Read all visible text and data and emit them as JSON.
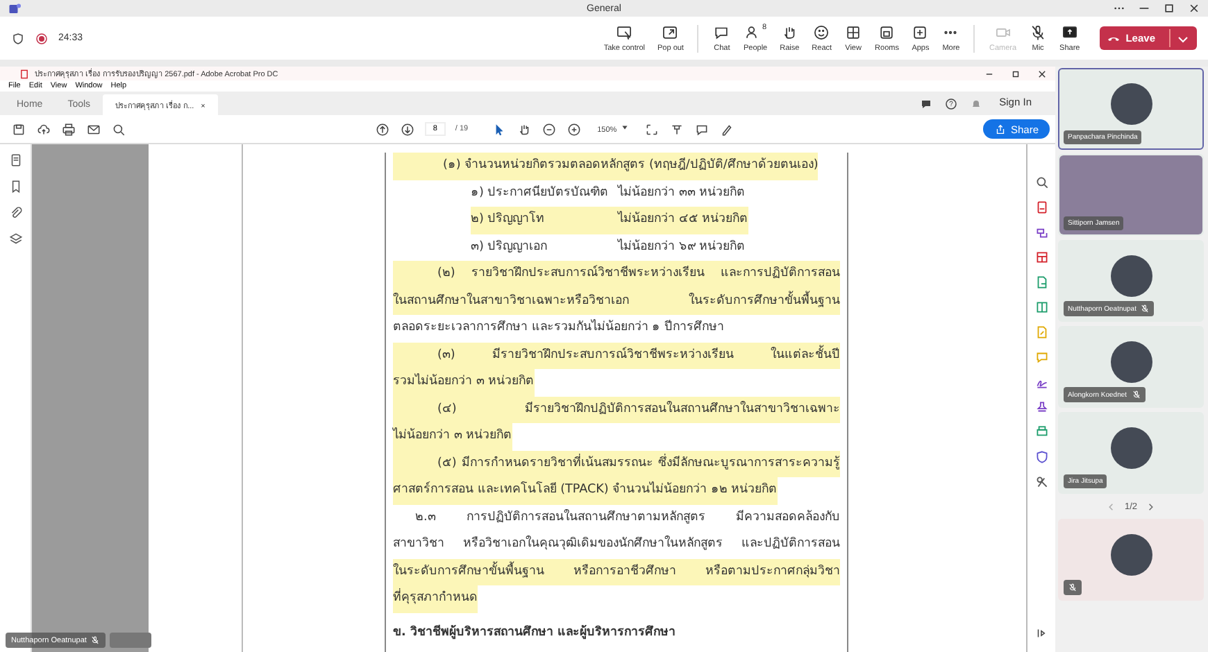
{
  "teams": {
    "title": "General",
    "timer": "24:33",
    "controls": [
      {
        "label": "Take control",
        "disabled": false
      },
      {
        "label": "Pop out",
        "disabled": false
      },
      {
        "label": "Chat",
        "disabled": false
      },
      {
        "label": "People",
        "disabled": false,
        "count": "8"
      },
      {
        "label": "Raise",
        "disabled": false
      },
      {
        "label": "React",
        "disabled": false
      },
      {
        "label": "View",
        "disabled": false
      },
      {
        "label": "Rooms",
        "disabled": false
      },
      {
        "label": "Apps",
        "disabled": false
      },
      {
        "label": "More",
        "disabled": false
      },
      {
        "label": "Camera",
        "disabled": true
      },
      {
        "label": "Mic",
        "disabled": false
      },
      {
        "label": "Share",
        "disabled": false
      }
    ],
    "leave": "Leave"
  },
  "acrobat": {
    "title": "ประกาศคุรุสภา เรื่อง การรับรองปริญญา 2567.pdf - Adobe Acrobat Pro DC",
    "menu": [
      "File",
      "Edit",
      "View",
      "Window",
      "Help"
    ],
    "tabs": [
      {
        "label": "Home",
        "selected": false
      },
      {
        "label": "Tools",
        "selected": false
      },
      {
        "label": "ประกาศคุรุสภา เรื่อง ก...",
        "selected": true,
        "close": "×"
      }
    ],
    "sign_in": "Sign In",
    "page": "8",
    "page_total": "/ 19",
    "zoom": "150%",
    "share": "Share"
  },
  "document": {
    "lines": [
      {
        "kind": "indent",
        "highlighted": true,
        "text": "(๑) จำนวนหน่วยกิตรวมตลอดหลักสูตร (ทฤษฎี/ปฏิบัติ/ศึกษาด้วยตนเอง)"
      },
      {
        "kind": "item",
        "highlighted": false,
        "text": "๑) ประกาศนียบัตรบัณฑิต",
        "value": "ไม่น้อยกว่า ๓๓ หน่วยกิต"
      },
      {
        "kind": "item",
        "highlighted": true,
        "text": "๒) ปริญญาโท",
        "value": "ไม่น้อยกว่า ๔๕ หน่วยกิต"
      },
      {
        "kind": "item",
        "highlighted": false,
        "text": "๓) ปริญญาเอก",
        "value": "ไม่น้อยกว่า ๖๙ หน่วยกิต"
      },
      {
        "kind": "first",
        "highlighted": true,
        "text": "(๒) รายวิชาฝึกประสบการณ์วิชาชีพระหว่างเรียน และการปฏิบัติการสอน"
      },
      {
        "kind": "full",
        "highlighted": true,
        "text": "ในสถานศึกษาในสาขาวิชาเฉพาะหรือวิชาเอก ในระดับการศึกษาขั้นพื้นฐาน"
      },
      {
        "kind": "last",
        "highlighted": false,
        "text": "ตลอดระยะเวลาการศึกษา และรวมกันไม่น้อยกว่า ๑ ปีการศึกษา"
      },
      {
        "kind": "first",
        "highlighted": true,
        "text": "(๓) มีรายวิชาฝึกประสบการณ์วิชาชีพระหว่างเรียน ในแต่ละชั้นปี"
      },
      {
        "kind": "last",
        "highlighted": true,
        "text": "รวมไม่น้อยกว่า ๓ หน่วยกิต"
      },
      {
        "kind": "first",
        "highlighted": true,
        "text": "(๔) มีรายวิชาฝึกปฏิบัติการสอนในสถานศึกษาในสาขาวิชาเฉพาะ"
      },
      {
        "kind": "last",
        "highlighted": true,
        "text": "ไม่น้อยกว่า ๓ หน่วยกิต"
      },
      {
        "kind": "first",
        "highlighted": true,
        "text": "(๕) มีการกำหนดรายวิชาที่เน้นสมรรถนะ ซึ่งมีลักษณะบูรณาการสาระความรู้"
      },
      {
        "kind": "last",
        "highlighted": true,
        "text": "ศาสตร์การสอน และเทคโนโลยี (TPACK) จำนวนไม่น้อยกว่า ๑๒ หน่วยกิต"
      },
      {
        "kind": "section",
        "highlighted": false,
        "text": "๒.๓ การปฏิบัติการสอนในสถานศึกษาตามหลักสูตร มีความสอดคล้องกับ"
      },
      {
        "kind": "full",
        "highlighted": false,
        "text": "สาขาวิชา หรือวิชาเอกในคุณวุฒิเดิมของนักศึกษาในหลักสูตร และปฏิบัติการสอน"
      },
      {
        "kind": "full",
        "highlighted": true,
        "text": "ในระดับการศึกษาขั้นพื้นฐาน หรือการอาชีวศึกษา หรือตามประกาศกลุ่มวิชา"
      },
      {
        "kind": "last",
        "highlighted": true,
        "text": "ที่คุรุสภากำหนด"
      },
      {
        "kind": "heading",
        "highlighted": false,
        "text": "ข. วิชาชีพผู้บริหารสถานศึกษา และผู้บริหารการศึกษา"
      }
    ]
  },
  "participants": {
    "tiles": [
      {
        "kind": "avatar",
        "name": "Panpachara Pinchinda",
        "muted": false,
        "selected": true
      },
      {
        "kind": "video",
        "name": "Sittiporn Jamsen",
        "muted": false,
        "selected": false
      },
      {
        "kind": "avatar",
        "name": "Nutthaporn Oeatnupat",
        "muted": true,
        "selected": false
      },
      {
        "kind": "avatar",
        "name": "Alongkorn Koednet",
        "muted": true,
        "selected": false
      },
      {
        "kind": "avatar",
        "name": "Jira Jitsupa",
        "muted": false,
        "selected": false
      }
    ],
    "pager": "1/2",
    "more_tiles": [
      {
        "kind": "avatar",
        "muted": true,
        "selected": false
      }
    ]
  },
  "overlay_tags": [
    {
      "name": "Nutthaporn Oeatnupat",
      "muted": true
    }
  ]
}
